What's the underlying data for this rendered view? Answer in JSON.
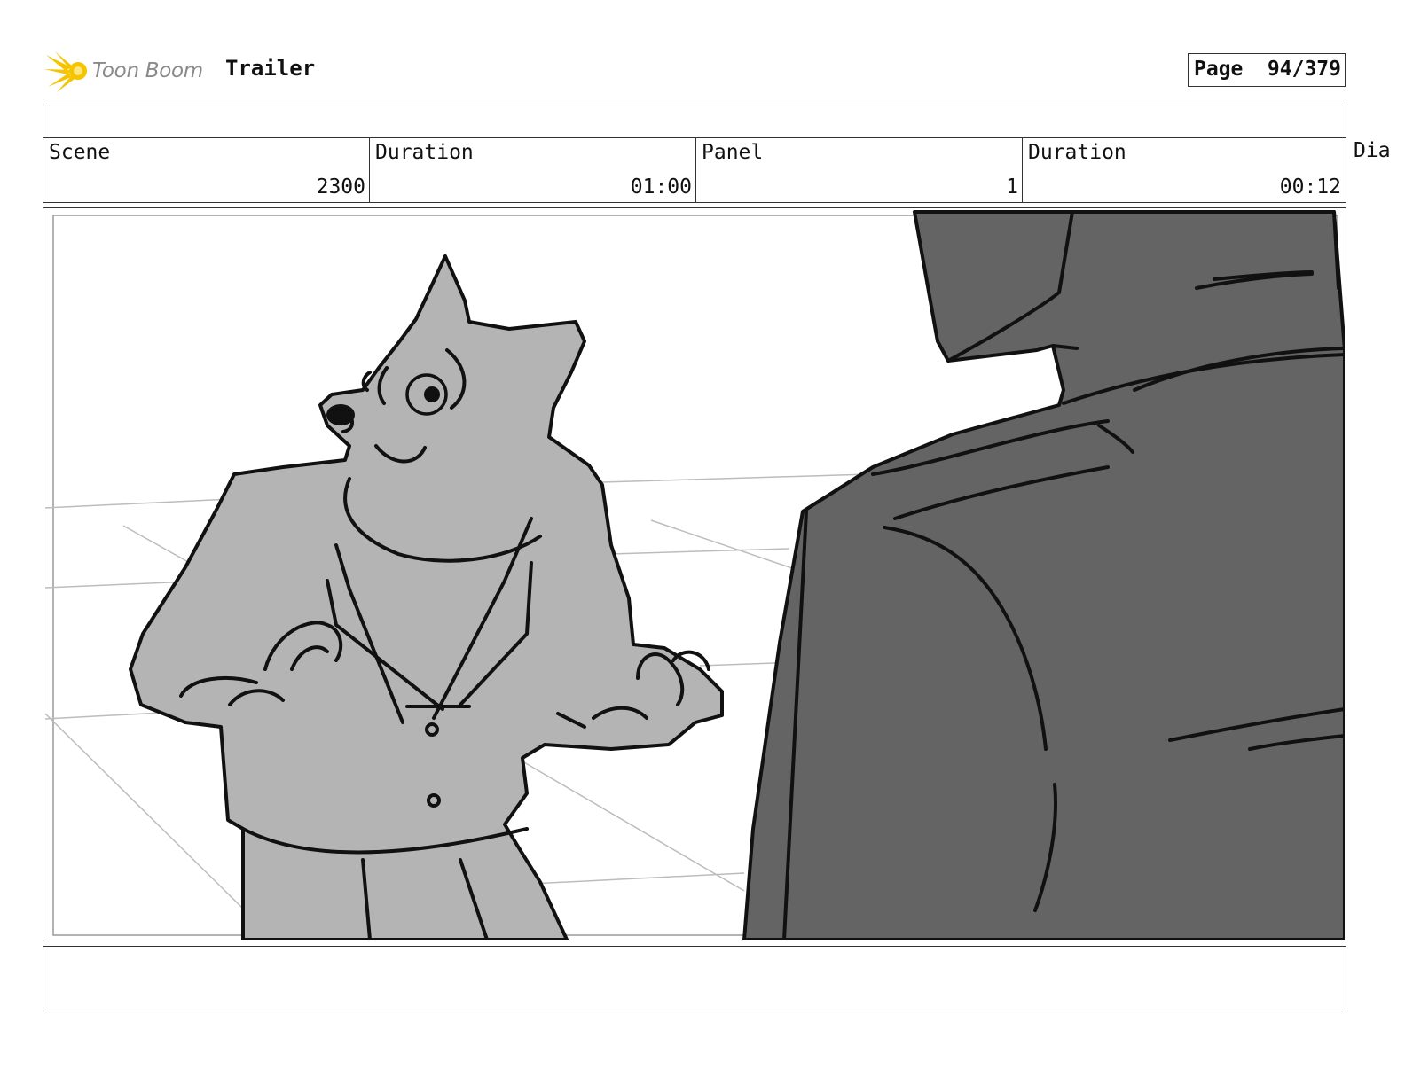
{
  "brand": {
    "logo_text": "Toon Boom",
    "accent_color": "#f5c400"
  },
  "project": {
    "title": "Trailer"
  },
  "page": {
    "label": "Page",
    "value": "94/379"
  },
  "header": {
    "cells": [
      {
        "label": "Scene",
        "value": "2300"
      },
      {
        "label": "Duration",
        "value": "01:00"
      },
      {
        "label": "Panel",
        "value": "1"
      },
      {
        "label": "Duration",
        "value": "00:12"
      }
    ],
    "dialogue_label": "Dia"
  },
  "panel": {
    "colors": {
      "character_fill": "#b4b4b4",
      "foreground_fill": "#646464",
      "line": "#111111",
      "floor_lines": "#bcbcbc"
    }
  },
  "footer": {
    "notes": ""
  }
}
